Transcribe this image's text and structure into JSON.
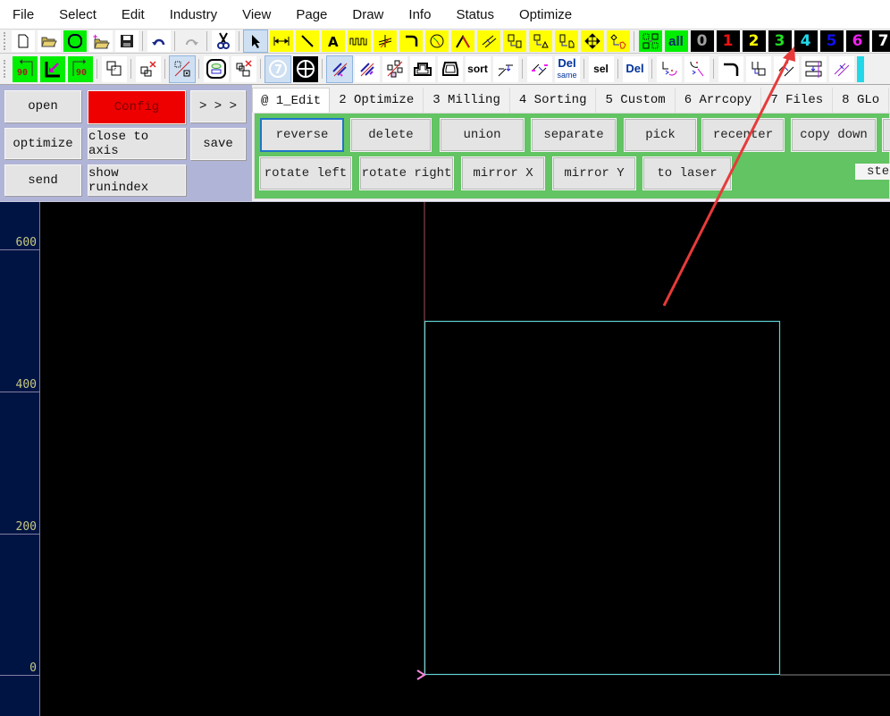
{
  "menu": [
    "File",
    "Select",
    "Edit",
    "Industry",
    "View",
    "Page",
    "Draw",
    "Info",
    "Status",
    "Optimize"
  ],
  "toolbar1": {
    "layers": [
      {
        "label": "0",
        "color": "#a0a0a0"
      },
      {
        "label": "1",
        "color": "#ee1111"
      },
      {
        "label": "2",
        "color": "#ffff00"
      },
      {
        "label": "3",
        "color": "#22dd22"
      },
      {
        "label": "4",
        "color": "#22d8e8"
      },
      {
        "label": "5",
        "color": "#1010ee"
      },
      {
        "label": "6",
        "color": "#ee22ee"
      },
      {
        "label": "7",
        "color": "#ffffff"
      }
    ],
    "all_label": "all"
  },
  "toolbar2": {
    "rot_left_label": "90",
    "rot_right_label": "90",
    "sort_label": "sort",
    "del_same_label": "Del",
    "del_same_sub": "same",
    "sel_label": "sel",
    "del_label": "Del"
  },
  "left_panel": {
    "open": "open",
    "config": "Config",
    "more": "> > >",
    "optimize": "optimize",
    "close_to_axis": "close to axis",
    "save": "save",
    "send": "send",
    "show_runindex": "show runindex"
  },
  "tabs": [
    "@ 1_Edit",
    "2 Optimize",
    "3 Milling",
    "4 Sorting",
    "5 Custom",
    "6 Arrcopy",
    "7 Files",
    "8 GLo"
  ],
  "edit_tab": {
    "row1": [
      "reverse",
      "delete",
      "union",
      "separate",
      "pick",
      "recenter",
      "copy down"
    ],
    "row2": [
      "rotate left",
      "rotate right",
      "mirror X",
      "mirror Y",
      "to laser"
    ],
    "step_label": "step"
  },
  "ruler": {
    "ticks": [
      "600",
      "400",
      "200",
      "0"
    ]
  },
  "colors": {
    "shape_outline": "#5fd0d0",
    "annotation_arrow": "#e83a3a",
    "config_button": "#ee0000",
    "tab_panel": "#62c462"
  }
}
